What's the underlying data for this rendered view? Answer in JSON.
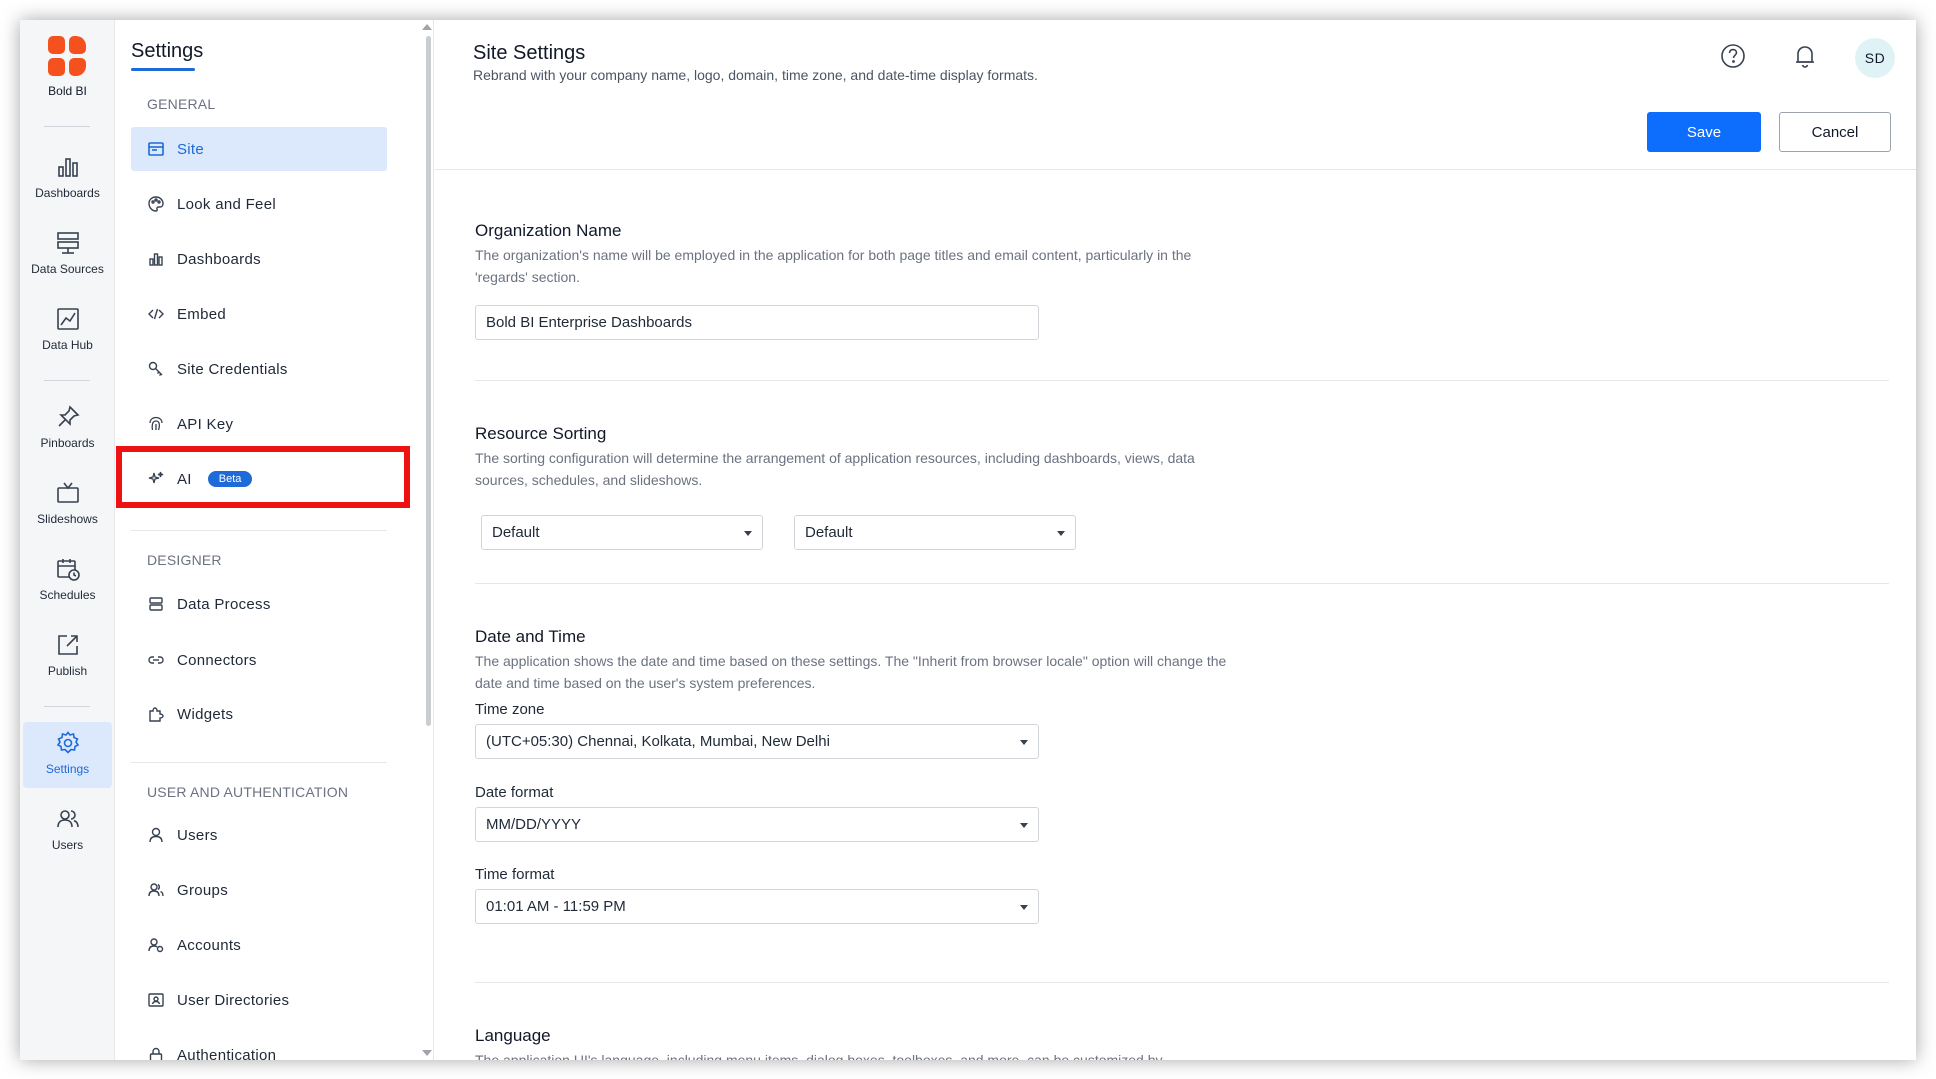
{
  "brand": {
    "name": "Bold BI"
  },
  "rail": [
    {
      "label": "Dashboards",
      "icon": "bar-chart-icon"
    },
    {
      "label": "Data Sources",
      "icon": "database-icon"
    },
    {
      "label": "Data Hub",
      "icon": "data-hub-icon"
    },
    {
      "label": "Pinboards",
      "icon": "pin-icon"
    },
    {
      "label": "Slideshows",
      "icon": "tv-icon"
    },
    {
      "label": "Schedules",
      "icon": "calendar-clock-icon"
    },
    {
      "label": "Publish",
      "icon": "publish-icon"
    },
    {
      "label": "Settings",
      "icon": "gear-icon"
    },
    {
      "label": "Users",
      "icon": "users-icon"
    }
  ],
  "settings_nav": {
    "title": "Settings",
    "sections": [
      {
        "header": "GENERAL",
        "items": [
          {
            "label": "Site",
            "icon": "site-icon"
          },
          {
            "label": "Look and Feel",
            "icon": "palette-icon"
          },
          {
            "label": "Dashboards",
            "icon": "bar-chart-icon"
          },
          {
            "label": "Embed",
            "icon": "code-icon"
          },
          {
            "label": "Site Credentials",
            "icon": "key-icon"
          },
          {
            "label": "API Key",
            "icon": "fingerprint-icon"
          },
          {
            "label": "AI",
            "icon": "sparkle-icon",
            "badge": "Beta"
          }
        ]
      },
      {
        "header": "DESIGNER",
        "items": [
          {
            "label": "Data Process",
            "icon": "server-icon"
          },
          {
            "label": "Connectors",
            "icon": "link-icon"
          },
          {
            "label": "Widgets",
            "icon": "puzzle-icon"
          }
        ]
      },
      {
        "header": "USER AND AUTHENTICATION",
        "items": [
          {
            "label": "Users",
            "icon": "user-icon"
          },
          {
            "label": "Groups",
            "icon": "group-icon"
          },
          {
            "label": "Accounts",
            "icon": "accounts-icon"
          },
          {
            "label": "User Directories",
            "icon": "directory-icon"
          },
          {
            "label": "Authentication",
            "icon": "lock-icon"
          }
        ]
      }
    ]
  },
  "header": {
    "title": "Site Settings",
    "subtitle": "Rebrand with your company name, logo, domain, time zone, and date-time display formats.",
    "avatar": "SD",
    "save_label": "Save",
    "cancel_label": "Cancel"
  },
  "org": {
    "title": "Organization Name",
    "desc": "The organization's name will be employed in the application for both page titles and email content, particularly in the 'regards' section.",
    "value": "Bold BI Enterprise Dashboards"
  },
  "sorting": {
    "title": "Resource Sorting",
    "desc": "The sorting configuration will determine the arrangement of application resources, including dashboards, views, data sources, schedules, and slideshows.",
    "value1": "Default",
    "value2": "Default"
  },
  "datetime": {
    "title": "Date and Time",
    "desc": "The application shows the date and time based on these settings. The \"Inherit from browser locale\" option will change the date and time based on the user's system preferences.",
    "timezone_label": "Time zone",
    "timezone_value": "(UTC+05:30) Chennai, Kolkata, Mumbai, New Delhi",
    "dateformat_label": "Date format",
    "dateformat_value": "MM/DD/YYYY",
    "timeformat_label": "Time format",
    "timeformat_value": "01:01 AM - 11:59 PM"
  },
  "language": {
    "title": "Language",
    "desc": "The application UI's language, including menu items, dialog boxes, toolboxes, and more, can be customized by"
  },
  "colors": {
    "accent": "#1d6ad8",
    "primary_button": "#0d6efd",
    "brand": "#f4511e",
    "highlight": "#ee1111"
  }
}
